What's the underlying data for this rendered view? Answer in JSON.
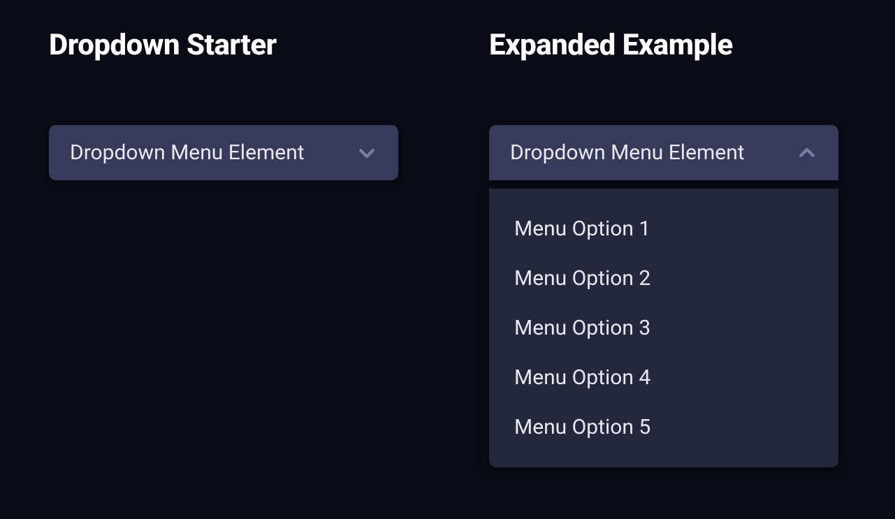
{
  "left": {
    "heading": "Dropdown Starter",
    "dropdown": {
      "label": "Dropdown Menu Element",
      "expanded": false
    }
  },
  "right": {
    "heading": "Expanded Example",
    "dropdown": {
      "label": "Dropdown Menu Element",
      "expanded": true,
      "options": [
        {
          "label": "Menu Option 1"
        },
        {
          "label": "Menu Option 2"
        },
        {
          "label": "Menu Option 3"
        },
        {
          "label": "Menu Option 4"
        },
        {
          "label": "Menu Option 5"
        }
      ]
    }
  },
  "colors": {
    "background": "#0a0b14",
    "toggle_bg": "#383a59",
    "menu_bg": "#25273d",
    "text": "#e9e7ef",
    "chevron": "#7d7aa6"
  }
}
